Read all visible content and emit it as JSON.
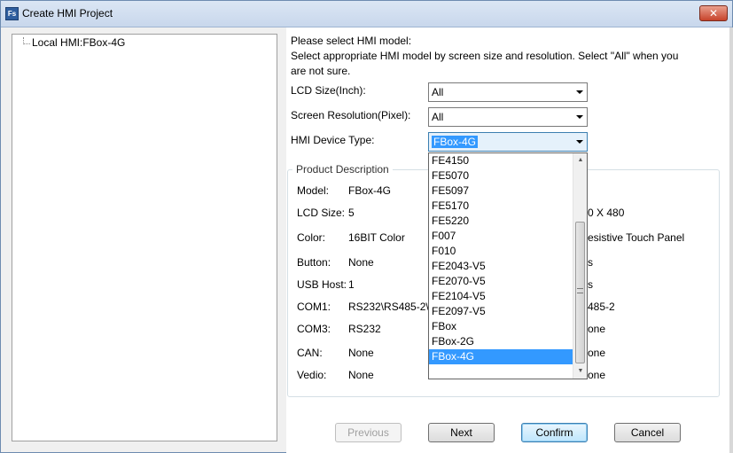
{
  "window": {
    "title": "Create HMI Project",
    "icon_text": "Fs",
    "close_label": "✕"
  },
  "tree": {
    "root_label": "Local HMI:FBox-4G"
  },
  "instructions": {
    "line1": "Please select HMI model:",
    "line2": "Select appropriate HMI model by screen size and resolution. Select \"All\" when you",
    "line3": "are not sure."
  },
  "form": {
    "lcd_size_label": "LCD Size(Inch):",
    "lcd_size_value": "All",
    "resolution_label": "Screen Resolution(Pixel):",
    "resolution_value": "All",
    "device_type_label": "HMI Device Type:",
    "device_type_value": "FBox-4G"
  },
  "dropdown": {
    "options": [
      "FE4150",
      "FE5070",
      "FE5097",
      "FE5170",
      "FE5220",
      "F007",
      "F010",
      "FE2043-V5",
      "FE2070-V5",
      "FE2104-V5",
      "FE2097-V5",
      "FBox",
      "FBox-2G",
      "FBox-4G"
    ],
    "selected": "FBox-4G",
    "scroll_up_icon": "▲",
    "scroll_down_icon": "▼"
  },
  "product": {
    "legend": "Product Description",
    "model_label": "Model:",
    "model_value": "FBox-4G",
    "lcd_label": "LCD Size:",
    "lcd_value": "5",
    "color_label": "Color:",
    "color_value": "16BIT Color",
    "button_label": "Button:",
    "button_value": "None",
    "usb_label": "USB Host:",
    "usb_value": "1",
    "com1_label": "COM1:",
    "com1_value": "RS232\\RS485-2\\",
    "com3_label": "COM3:",
    "com3_value": "RS232",
    "can_label": "CAN:",
    "can_value": "None",
    "vedio_label": "Vedio:",
    "vedio_value": "None",
    "right_col": {
      "resolution_partial": "0 X 480",
      "touch_partial": "esistive Touch Panel",
      "row4_partial": "s",
      "row5_partial": "s",
      "com2_partial": "485-2",
      "com4_partial": "one",
      "row_can_partial": "one",
      "row_vedio_partial": "one"
    }
  },
  "buttons": {
    "previous": "Previous",
    "next": "Next",
    "confirm": "Confirm",
    "cancel": "Cancel"
  }
}
